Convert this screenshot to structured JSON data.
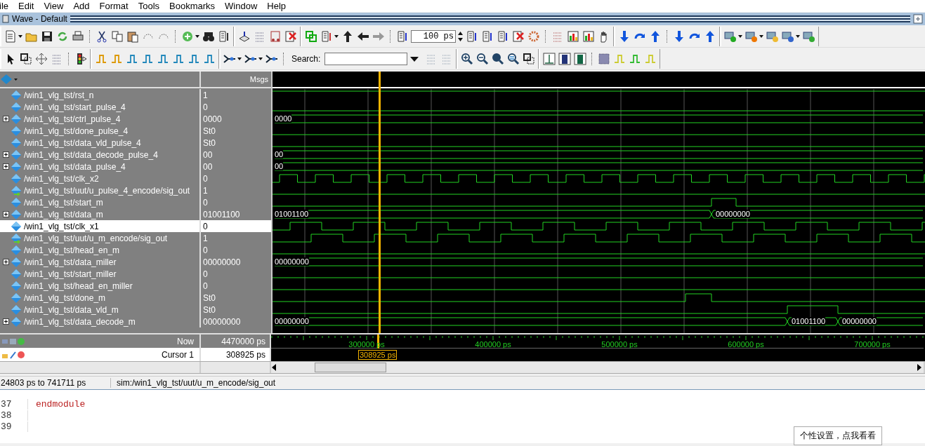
{
  "menu": [
    "ile",
    "Edit",
    "View",
    "Add",
    "Format",
    "Tools",
    "Bookmarks",
    "Window",
    "Help"
  ],
  "window": {
    "title": "Wave - Default"
  },
  "toolbar": {
    "time_step": "100 ps",
    "search_label": "Search:"
  },
  "wave_header": {
    "values_title": "Msgs"
  },
  "signals": [
    {
      "name": "/win1_vlg_tst/rst_n",
      "value": "1",
      "kind": "bit",
      "selected": false
    },
    {
      "name": "/win1_vlg_tst/start_pulse_4",
      "value": "0",
      "kind": "bit",
      "selected": false
    },
    {
      "name": "/win1_vlg_tst/ctrl_pulse_4",
      "value": "0000",
      "kind": "bus",
      "selected": false,
      "bus_labels": [
        "0000"
      ]
    },
    {
      "name": "/win1_vlg_tst/done_pulse_4",
      "value": "St0",
      "kind": "bit",
      "selected": false
    },
    {
      "name": "/win1_vlg_tst/data_vld_pulse_4",
      "value": "St0",
      "kind": "bit",
      "selected": false
    },
    {
      "name": "/win1_vlg_tst/data_decode_pulse_4",
      "value": "00",
      "kind": "bus",
      "selected": false,
      "bus_labels": [
        "00"
      ]
    },
    {
      "name": "/win1_vlg_tst/data_pulse_4",
      "value": "00",
      "kind": "bus",
      "selected": false,
      "bus_labels": [
        "00"
      ]
    },
    {
      "name": "/win1_vlg_tst/clk_x2",
      "value": "0",
      "kind": "bit",
      "selected": false
    },
    {
      "name": "/win1_vlg_tst/uut/u_pulse_4_encode/sig_out",
      "value": "1",
      "kind": "output",
      "selected": false
    },
    {
      "name": "/win1_vlg_tst/start_m",
      "value": "0",
      "kind": "bit",
      "selected": false
    },
    {
      "name": "/win1_vlg_tst/data_m",
      "value": "01001100",
      "kind": "bus",
      "selected": false,
      "bus_labels": [
        "01001100",
        "00000000"
      ]
    },
    {
      "name": "/win1_vlg_tst/clk_x1",
      "value": "0",
      "kind": "bit",
      "selected": true
    },
    {
      "name": "/win1_vlg_tst/uut/u_m_encode/sig_out",
      "value": "1",
      "kind": "output",
      "selected": false
    },
    {
      "name": "/win1_vlg_tst/head_en_m",
      "value": "0",
      "kind": "bit",
      "selected": false
    },
    {
      "name": "/win1_vlg_tst/data_miller",
      "value": "00000000",
      "kind": "bus",
      "selected": false,
      "bus_labels": [
        "00000000"
      ]
    },
    {
      "name": "/win1_vlg_tst/start_miller",
      "value": "0",
      "kind": "bit",
      "selected": false
    },
    {
      "name": "/win1_vlg_tst/head_en_miller",
      "value": "0",
      "kind": "bit",
      "selected": false
    },
    {
      "name": "/win1_vlg_tst/done_m",
      "value": "St0",
      "kind": "bit",
      "selected": false
    },
    {
      "name": "/win1_vlg_tst/data_vld_m",
      "value": "St0",
      "kind": "bit",
      "selected": false
    },
    {
      "name": "/win1_vlg_tst/data_decode_m",
      "value": "00000000",
      "kind": "bus",
      "selected": false,
      "bus_labels": [
        "00000000",
        "01001100",
        "00000000"
      ]
    }
  ],
  "cursors": {
    "now_label": "Now",
    "now_value": "4470000 ps",
    "cursor_label": "Cursor 1",
    "cursor_value": "308925 ps",
    "cursor_flag": "308925 ps"
  },
  "timeline": {
    "ticks": [
      "300000 ps",
      "400000 ps",
      "500000 ps",
      "600000 ps",
      "700000 ps"
    ]
  },
  "status_bar": {
    "range": "24803 ps to 741711 ps",
    "path": "sim:/win1_vlg_tst/uut/u_m_encode/sig_out"
  },
  "editor": {
    "lines": [
      {
        "number": "37",
        "code": "endmodule"
      },
      {
        "number": "38"
      },
      {
        "number": "39"
      }
    ]
  },
  "tooltip": "个性设置，点我看看"
}
